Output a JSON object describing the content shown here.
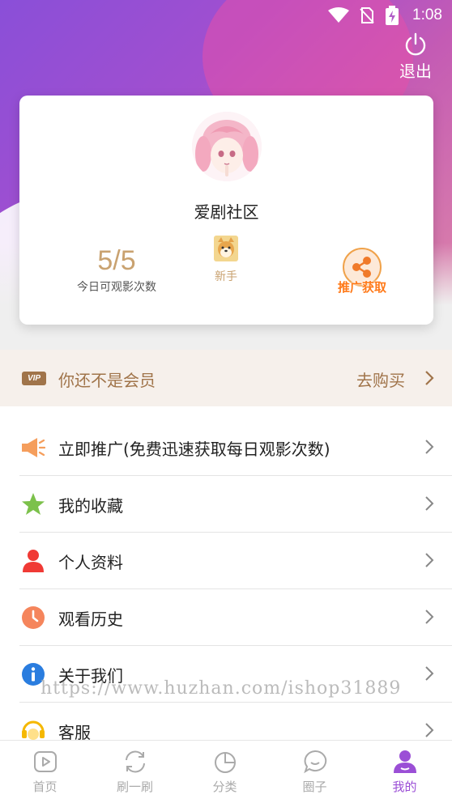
{
  "status_bar": {
    "time": "1:08"
  },
  "header": {
    "logout_label": "退出"
  },
  "profile": {
    "nickname": "爱剧社区",
    "quota_value": "5/5",
    "quota_label": "今日可观影次数",
    "level_label": "新手",
    "promo_label": "推广获取"
  },
  "vip": {
    "icon_text": "VIP",
    "status_text": "你还不是会员",
    "buy_label": "去购买"
  },
  "menu": {
    "items": [
      {
        "label": "立即推广(免费迅速获取每日观影次数)",
        "icon": "megaphone-icon"
      },
      {
        "label": "我的收藏",
        "icon": "star-icon"
      },
      {
        "label": "个人资料",
        "icon": "person-icon"
      },
      {
        "label": "观看历史",
        "icon": "clock-icon"
      },
      {
        "label": "关于我们",
        "icon": "info-icon"
      },
      {
        "label": "客服",
        "icon": "headset-icon"
      }
    ]
  },
  "watermark": "https://www.huzhan.com/ishop31889",
  "tabs": [
    {
      "label": "首页",
      "icon": "play-icon"
    },
    {
      "label": "刷一刷",
      "icon": "refresh-icon"
    },
    {
      "label": "分类",
      "icon": "pie-icon"
    },
    {
      "label": "圈子",
      "icon": "chat-icon"
    },
    {
      "label": "我的",
      "icon": "profile-icon",
      "active": true
    }
  ],
  "colors": {
    "accent": "#9b4fd6",
    "gold": "#c9a270",
    "vip_brown": "#a0744a",
    "promo_orange": "#ff7a1a"
  }
}
